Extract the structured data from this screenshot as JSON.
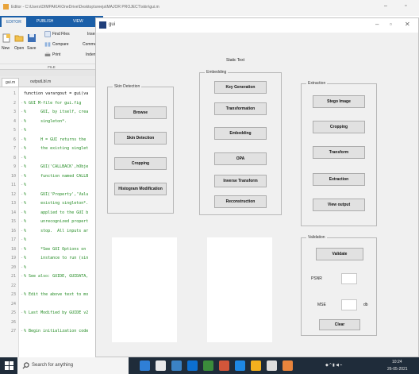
{
  "editor": {
    "title": "Editor - C:\\Users\\DIMPAKIA\\OneDrive\\Desktop\\sreeja\\MAJOR PROJECT\\skin\\gui.m",
    "ribbon_tabs": [
      "EDITOR",
      "PUBLISH",
      "VIEW"
    ],
    "ribbon": {
      "new": "New",
      "open": "Open",
      "save": "Save",
      "find_files": "Find Files",
      "compare": "Compare",
      "print": "Print",
      "insert": "Insert",
      "comment": "Comment",
      "indent": "Indent",
      "file_group": "FILE"
    },
    "file_tabs": [
      "gui.m",
      "outputLbl.m"
    ],
    "code_lines": [
      {
        "n": "1",
        "t": "function varargout = gui(va"
      },
      {
        "n": "2",
        "t": "% GUI M-file for gui.fig"
      },
      {
        "n": "3",
        "t": "%      GUI, by itself, crea"
      },
      {
        "n": "4",
        "t": "%      singleton*."
      },
      {
        "n": "5",
        "t": "%"
      },
      {
        "n": "6",
        "t": "%      H = GUI returns the"
      },
      {
        "n": "7",
        "t": "%      the existing singlet"
      },
      {
        "n": "8",
        "t": "%"
      },
      {
        "n": "9",
        "t": "%      GUI('CALLBACK',hObje"
      },
      {
        "n": "10",
        "t": "%      function named CALLB"
      },
      {
        "n": "11",
        "t": "%"
      },
      {
        "n": "12",
        "t": "%      GUI('Property','Valu"
      },
      {
        "n": "13",
        "t": "%      existing singleton*."
      },
      {
        "n": "14",
        "t": "%      applied to the GUI b"
      },
      {
        "n": "15",
        "t": "%      unrecognized propert"
      },
      {
        "n": "16",
        "t": "%      stop.  All inputs ar"
      },
      {
        "n": "17",
        "t": "%"
      },
      {
        "n": "18",
        "t": "%      *See GUI Options on"
      },
      {
        "n": "19",
        "t": "%      instance to run (sin"
      },
      {
        "n": "20",
        "t": "%"
      },
      {
        "n": "21",
        "t": "% See also: GUIDE, GUIDATA,"
      },
      {
        "n": "22",
        "t": ""
      },
      {
        "n": "23",
        "t": "% Edit the above text to mo"
      },
      {
        "n": "24",
        "t": ""
      },
      {
        "n": "25",
        "t": "% Last Modified by GUIDE v2"
      },
      {
        "n": "26",
        "t": ""
      },
      {
        "n": "27",
        "t": "% Begin initialization code"
      }
    ]
  },
  "gui": {
    "window_title": "gui",
    "static_text": "Static Text",
    "skin_panel": {
      "title": "Skin Detection",
      "buttons": [
        "Browse",
        "Skin Detection",
        "Cropping",
        "Histogram Modification"
      ]
    },
    "embedding_panel": {
      "title": "Embedding",
      "buttons": [
        "Key Generation",
        "Transformation",
        "Embedding",
        "OPA",
        "Inverse Transform",
        "Reconstruction"
      ]
    },
    "extraction_panel": {
      "title": "Extraction",
      "buttons": [
        "Stego Image",
        "Cropping",
        "Transform",
        "Extraction",
        "View output"
      ]
    },
    "validation_panel": {
      "title": "Validation",
      "validate": "Validate",
      "psnr_label": "PSNR",
      "mse_label": "MSE",
      "db_label": "db",
      "clear": "Clear"
    }
  },
  "taskbar": {
    "search_placeholder": "Search for anything",
    "time": "10:24",
    "date": "26-05-2021"
  }
}
